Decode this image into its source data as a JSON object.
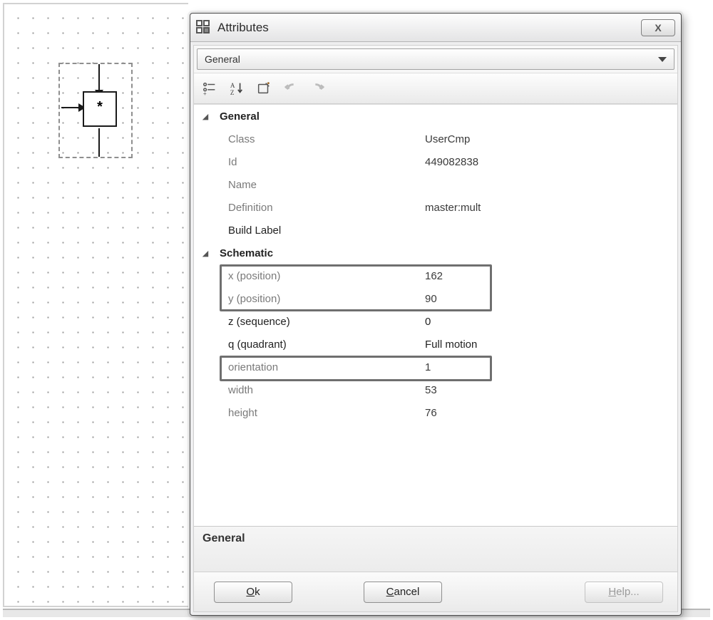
{
  "window": {
    "title": "Attributes",
    "close_glyph": "X"
  },
  "combo": {
    "selected": "General"
  },
  "groups": {
    "general": {
      "label": "General",
      "class_key": "Class",
      "class_val": "UserCmp",
      "id_key": "Id",
      "id_val": "449082838",
      "name_key": "Name",
      "name_val": "",
      "def_key": "Definition",
      "def_val": "master:mult",
      "build_key": "Build Label",
      "build_val": ""
    },
    "schematic": {
      "label": "Schematic",
      "x_key": "x (position)",
      "x_val": "162",
      "y_key": "y (position)",
      "y_val": "90",
      "z_key": "z (sequence)",
      "z_val": "0",
      "q_key": "q (quadrant)",
      "q_val": "Full motion",
      "orient_key": "orientation",
      "orient_val": "1",
      "w_key": "width",
      "w_val": "53",
      "h_key": "height",
      "h_val": "76"
    }
  },
  "help_header": "General",
  "buttons": {
    "ok": "Ok",
    "cancel": "Cancel",
    "help": "Help..."
  },
  "canvas_block": {
    "symbol": "*"
  }
}
